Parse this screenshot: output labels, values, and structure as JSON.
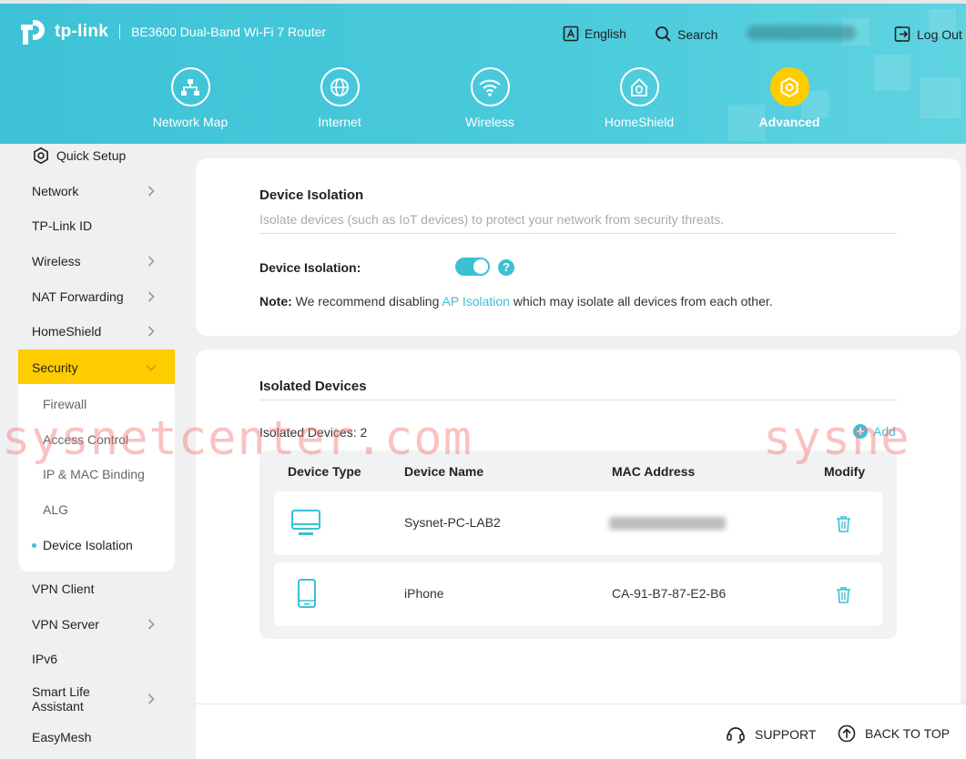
{
  "brand": {
    "name": "tp-link",
    "model": "BE3600 Dual-Band Wi-Fi 7 Router"
  },
  "topbar": {
    "language": "English",
    "search": "Search",
    "logout": "Log Out"
  },
  "nav": [
    {
      "label": "Network Map",
      "icon": "network-map-icon"
    },
    {
      "label": "Internet",
      "icon": "globe-icon"
    },
    {
      "label": "Wireless",
      "icon": "wifi-icon"
    },
    {
      "label": "HomeShield",
      "icon": "homeshield-icon"
    },
    {
      "label": "Advanced",
      "icon": "gear-icon",
      "active": true
    }
  ],
  "sidebar": {
    "quick_setup": "Quick Setup",
    "items": [
      "Network",
      "TP-Link ID",
      "Wireless",
      "NAT Forwarding",
      "HomeShield",
      "Security",
      "VPN Client",
      "VPN Server",
      "IPv6",
      "Smart Life Assistant",
      "EasyMesh"
    ],
    "security_sub": [
      "Firewall",
      "Access Control",
      "IP & MAC Binding",
      "ALG",
      "Device Isolation"
    ]
  },
  "isolation": {
    "title": "Device Isolation",
    "description": "Isolate devices (such as IoT devices) to protect your network from security threats.",
    "toggle_label": "Device Isolation:",
    "toggle_on": true,
    "note_bold": "Note:",
    "note_pre": " We recommend disabling ",
    "note_link": "AP Isolation",
    "note_post": " which may isolate all devices from each other."
  },
  "isolated": {
    "title": "Isolated Devices",
    "count_label": "Isolated Devices: 2",
    "add_label": "Add",
    "headers": [
      "Device Type",
      "Device Name",
      "MAC Address",
      "Modify"
    ],
    "rows": [
      {
        "type_icon": "desktop-icon",
        "name": "Sysnet-PC-LAB2",
        "mac": ""
      },
      {
        "type_icon": "phone-icon",
        "name": "iPhone",
        "mac": "CA-91-B7-87-E2-B6"
      }
    ]
  },
  "footer": {
    "support": "SUPPORT",
    "back_to_top": "BACK TO TOP"
  },
  "watermark": {
    "text1": "sysnetcenter.com",
    "text2": "sysne"
  },
  "colors": {
    "accent": "#3cc0d4",
    "active": "#ffcc00",
    "header": "#4bcbdc"
  }
}
